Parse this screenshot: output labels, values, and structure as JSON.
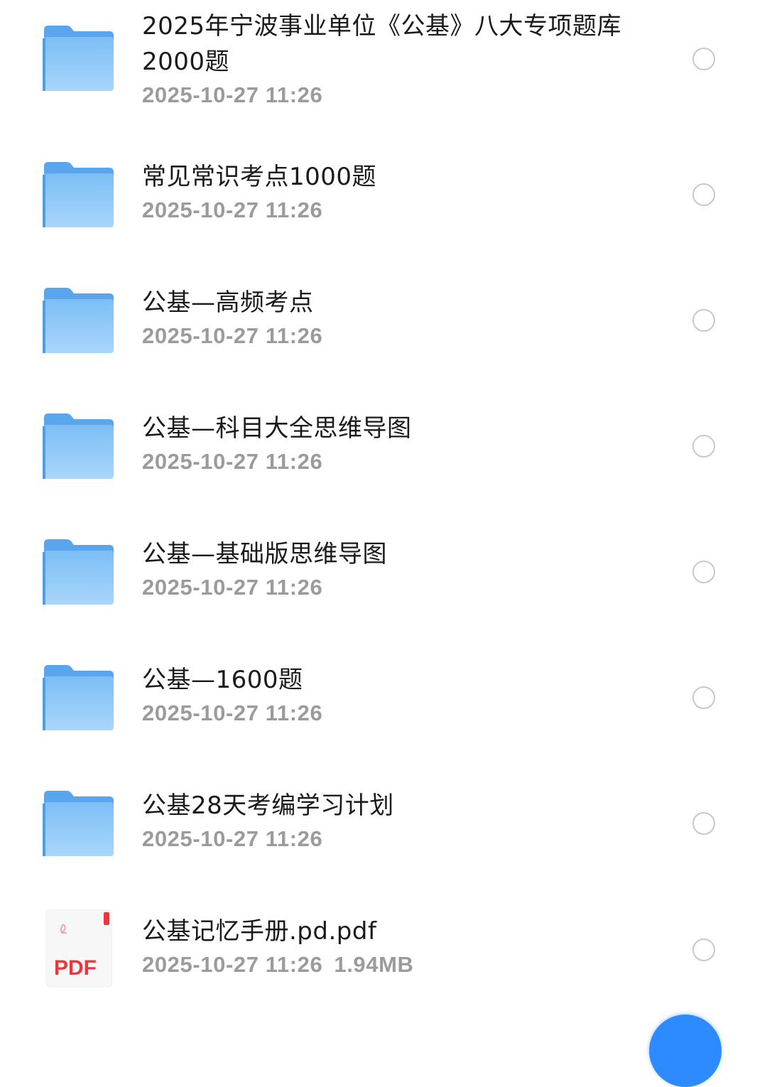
{
  "files": [
    {
      "type": "folder",
      "icon": "folder-icon",
      "name": "2025年宁波事业单位《公基》八大专项题库2000题",
      "modified": "2025-10-27 11:26"
    },
    {
      "type": "folder",
      "icon": "folder-icon",
      "name": "常见常识考点1000题",
      "modified": "2025-10-27 11:26"
    },
    {
      "type": "folder",
      "icon": "folder-icon",
      "name": "公基—高频考点",
      "modified": "2025-10-27 11:26"
    },
    {
      "type": "folder",
      "icon": "folder-icon",
      "name": "公基—科目大全思维导图",
      "modified": "2025-10-27 11:26"
    },
    {
      "type": "folder",
      "icon": "folder-icon",
      "name": "公基—基础版思维导图",
      "modified": "2025-10-27 11:26"
    },
    {
      "type": "folder",
      "icon": "folder-icon",
      "name": "公基—1600题",
      "modified": "2025-10-27 11:26"
    },
    {
      "type": "folder",
      "icon": "folder-icon",
      "name": "公基28天考编学习计划",
      "modified": "2025-10-27 11:26"
    },
    {
      "type": "pdf",
      "icon": "pdf-file-icon",
      "icon_label": "PDF",
      "name": "公基记忆手册.pd.pdf",
      "modified": "2025-10-27 11:26",
      "size": "1.94MB"
    }
  ],
  "colors": {
    "folder": "#6bb3f2",
    "folder_tab": "#5aa6ee",
    "pdf_accent": "#e8383d",
    "fab": "#2d8bff"
  }
}
